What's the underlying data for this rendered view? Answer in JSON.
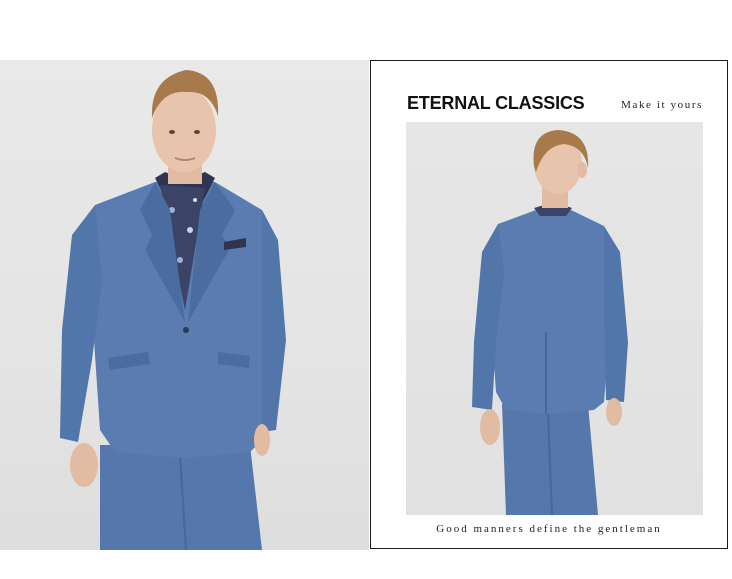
{
  "panel": {
    "headline": "ETERNAL CLASSICS",
    "tagline": "Make it yours",
    "footer": "Good manners define the gentleman"
  },
  "colors": {
    "suit": "#5a7cb0",
    "suit_shadow": "#46679a",
    "hair": "#a8794b",
    "skin": "#e8c4ad",
    "background": "#e6e6e6",
    "border": "#1a1a1a"
  },
  "images": {
    "left": "model-front-view-blue-suit",
    "right": "model-back-view-blue-suit"
  }
}
